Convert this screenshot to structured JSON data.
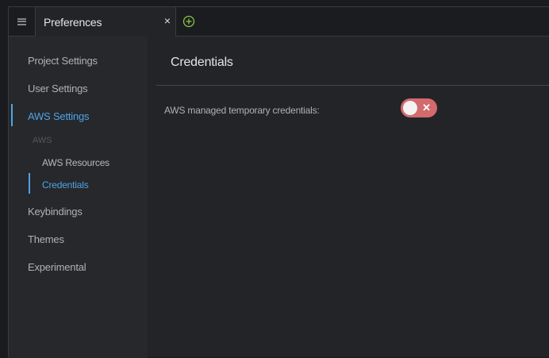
{
  "tabs": {
    "active_title": "Preferences",
    "close_glyph": "×",
    "icons": {
      "menu": "hamburger-icon",
      "add": "plus-circle-icon"
    },
    "add_icon_color": "#8bc34a"
  },
  "sidebar": {
    "items": [
      {
        "label": "Project Settings"
      },
      {
        "label": "User Settings"
      },
      {
        "label": "AWS Settings"
      },
      {
        "label": "Keybindings"
      },
      {
        "label": "Themes"
      },
      {
        "label": "Experimental"
      }
    ],
    "group_label": "AWS",
    "sub_items": [
      {
        "label": "AWS Resources"
      },
      {
        "label": "Credentials"
      }
    ],
    "accent_color": "#4ea3e6"
  },
  "main": {
    "section_title": "Credentials",
    "setting": {
      "label": "AWS managed temporary credentials:",
      "toggle_state": "off",
      "toggle_glyph": "✕",
      "toggle_color": "#d26a6e"
    }
  }
}
